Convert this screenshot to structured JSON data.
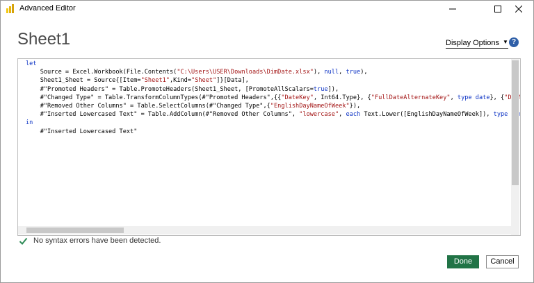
{
  "window": {
    "title": "Advanced Editor",
    "controls": {
      "minimize": "minimize",
      "maximize": "maximize",
      "close": "close"
    }
  },
  "header": {
    "title": "Sheet1",
    "display_options_label": "Display Options",
    "help_label": "?"
  },
  "editor": {
    "lines": [
      [
        {
          "t": "let",
          "c": "kw"
        }
      ],
      [
        {
          "t": "    Source = Excel.Workbook(File.Contents(",
          "c": ""
        },
        {
          "t": "\"C:\\Users\\USER\\Downloads\\DimDate.xlsx\"",
          "c": "str"
        },
        {
          "t": "), ",
          "c": ""
        },
        {
          "t": "null",
          "c": "kw"
        },
        {
          "t": ", ",
          "c": ""
        },
        {
          "t": "true",
          "c": "kw"
        },
        {
          "t": "),",
          "c": ""
        }
      ],
      [
        {
          "t": "    Sheet1_Sheet = Source{[Item=",
          "c": ""
        },
        {
          "t": "\"Sheet1\"",
          "c": "str"
        },
        {
          "t": ",Kind=",
          "c": ""
        },
        {
          "t": "\"Sheet\"",
          "c": "str"
        },
        {
          "t": "]}[Data],",
          "c": ""
        }
      ],
      [
        {
          "t": "    #\"Promoted Headers\" = Table.PromoteHeaders(Sheet1_Sheet, [PromoteAllScalars=",
          "c": ""
        },
        {
          "t": "true",
          "c": "kw"
        },
        {
          "t": "]),",
          "c": ""
        }
      ],
      [
        {
          "t": "    #\"Changed Type\" = Table.TransformColumnTypes(#\"Promoted Headers\",{{",
          "c": ""
        },
        {
          "t": "\"DateKey\"",
          "c": "str"
        },
        {
          "t": ", Int64.Type}, {",
          "c": ""
        },
        {
          "t": "\"FullDateAlternateKey\"",
          "c": "str"
        },
        {
          "t": ", ",
          "c": ""
        },
        {
          "t": "type date",
          "c": "kw"
        },
        {
          "t": "}, {",
          "c": ""
        },
        {
          "t": "\"DayNumberOfWeek\"",
          "c": "str"
        }
      ],
      [
        {
          "t": "    #\"Removed Other Columns\" = Table.SelectColumns(#\"Changed Type\",{",
          "c": ""
        },
        {
          "t": "\"EnglishDayNameOfWeek\"",
          "c": "str"
        },
        {
          "t": "}),",
          "c": ""
        }
      ],
      [
        {
          "t": "    #\"Inserted Lowercased Text\" = Table.AddColumn(#\"Removed Other Columns\", ",
          "c": ""
        },
        {
          "t": "\"lowercase\"",
          "c": "str"
        },
        {
          "t": ", ",
          "c": ""
        },
        {
          "t": "each",
          "c": "kw"
        },
        {
          "t": " Text.Lower([EnglishDayNameOfWeek]), ",
          "c": ""
        },
        {
          "t": "type text",
          "c": "kw"
        },
        {
          "t": ")",
          "c": ""
        }
      ],
      [
        {
          "t": "in",
          "c": "kw"
        }
      ],
      [
        {
          "t": "    #\"Inserted Lowercased Text\"",
          "c": ""
        }
      ]
    ]
  },
  "status": {
    "message": "No syntax errors have been detected."
  },
  "footer": {
    "done_label": "Done",
    "cancel_label": "Cancel"
  },
  "colors": {
    "done_button": "#217346",
    "keyword": "#0b32c4",
    "string": "#a31515",
    "check": "#2e8b57"
  }
}
